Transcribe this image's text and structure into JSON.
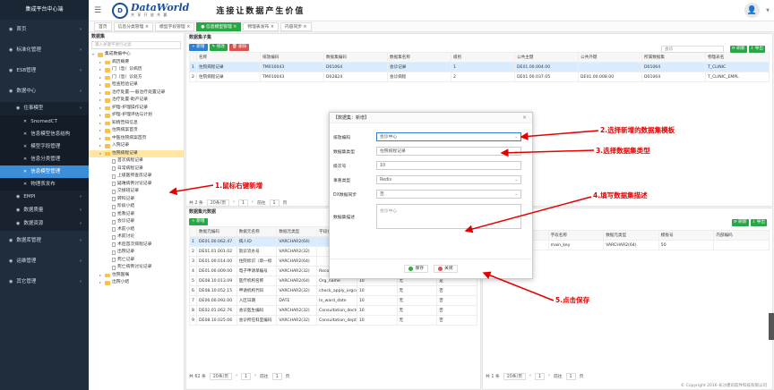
{
  "app_title": "集成平台中心端",
  "sidebar": {
    "items": [
      {
        "label": "首页",
        "level": 0
      },
      {
        "label": "标准化管理",
        "level": 0
      },
      {
        "label": "ESB管理",
        "level": 0
      },
      {
        "label": "数据中心",
        "level": 0
      },
      {
        "label": "住事模型",
        "level": 1
      },
      {
        "label": "SnomedCT",
        "level": 2
      },
      {
        "label": "信息模型信息结构",
        "level": 2
      },
      {
        "label": "模型字段管理",
        "level": 2
      },
      {
        "label": "信息分类管理",
        "level": 2
      },
      {
        "label": "信息模型管理",
        "level": 2,
        "active": true
      },
      {
        "label": "物理表发布",
        "level": 2
      },
      {
        "label": "EMPI",
        "level": 1
      },
      {
        "label": "数据质量",
        "level": 1
      },
      {
        "label": "数据资源",
        "level": 1
      },
      {
        "label": "数据库管理",
        "level": 0
      },
      {
        "label": "运维管理",
        "level": 0
      },
      {
        "label": "其它管理",
        "level": 0
      }
    ]
  },
  "header": {
    "logo_text": "DataWorld",
    "logo_sub": "共 享 开 放 共 赢",
    "slogan": "连接让数据产生价值"
  },
  "tabs": [
    {
      "label": "首页",
      "active": false
    },
    {
      "label": "信息分类管理 ×",
      "active": false
    },
    {
      "label": "模型字段管理 ×",
      "active": false
    },
    {
      "label": "● 信息模型管理 ×",
      "active": true
    },
    {
      "label": "物理表发布 ×",
      "active": false
    },
    {
      "label": "内容同步 ×",
      "active": false
    }
  ],
  "tree": {
    "title": "数据集",
    "search_placeholder": "输入关键字进行过滤",
    "nodes": [
      {
        "label": "集成数据中心",
        "depth": 0,
        "type": "folder",
        "open": true
      },
      {
        "label": "病历概要",
        "depth": 1,
        "type": "folder"
      },
      {
        "label": "门（急）诊病历",
        "depth": 1,
        "type": "folder"
      },
      {
        "label": "门（急）诊处方",
        "depth": 1,
        "type": "folder"
      },
      {
        "label": "检查检验记录",
        "depth": 1,
        "type": "folder"
      },
      {
        "label": "治疗处置-一般治疗处置记录",
        "depth": 1,
        "type": "folder"
      },
      {
        "label": "治疗处置-助产记录",
        "depth": 1,
        "type": "folder"
      },
      {
        "label": "护理-护理操作记录",
        "depth": 1,
        "type": "folder"
      },
      {
        "label": "护理-护理评估与计划",
        "depth": 1,
        "type": "folder"
      },
      {
        "label": "知情告知信息",
        "depth": 1,
        "type": "folder"
      },
      {
        "label": "住院病案首页",
        "depth": 1,
        "type": "folder"
      },
      {
        "label": "中医住院病案首页",
        "depth": 1,
        "type": "folder"
      },
      {
        "label": "入院记录",
        "depth": 1,
        "type": "folder"
      },
      {
        "label": "住院病程记录",
        "depth": 1,
        "type": "folder",
        "open": true,
        "selected": true
      },
      {
        "label": "首次病程记录",
        "depth": 2,
        "type": "file"
      },
      {
        "label": "日常病程记录",
        "depth": 2,
        "type": "file"
      },
      {
        "label": "上级医师查房记录",
        "depth": 2,
        "type": "file"
      },
      {
        "label": "疑难病例讨论记录",
        "depth": 2,
        "type": "file"
      },
      {
        "label": "交接班记录",
        "depth": 2,
        "type": "file"
      },
      {
        "label": "转科记录",
        "depth": 2,
        "type": "file"
      },
      {
        "label": "阶段小结",
        "depth": 2,
        "type": "file"
      },
      {
        "label": "抢救记录",
        "depth": 2,
        "type": "file"
      },
      {
        "label": "会诊记录",
        "depth": 2,
        "type": "file"
      },
      {
        "label": "术前小结",
        "depth": 2,
        "type": "file"
      },
      {
        "label": "术前讨论",
        "depth": 2,
        "type": "file"
      },
      {
        "label": "术后首次病程记录",
        "depth": 2,
        "type": "file"
      },
      {
        "label": "出院记录",
        "depth": 2,
        "type": "file"
      },
      {
        "label": "死亡记录",
        "depth": 2,
        "type": "file"
      },
      {
        "label": "死亡病例讨论记录",
        "depth": 2,
        "type": "file"
      },
      {
        "label": "住院医嘱",
        "depth": 1,
        "type": "folder"
      },
      {
        "label": "出院小结",
        "depth": 1,
        "type": "folder"
      }
    ]
  },
  "top_panel": {
    "title": "数据集子集",
    "buttons": {
      "add": "+ 新增",
      "edit": "✎ 修改",
      "delete": "🗑 删除"
    },
    "search_value": "会诊",
    "right_buttons": {
      "refresh": "⟳ 刷新",
      "export": "⇩ 导出"
    },
    "columns": [
      "",
      "名称",
      "排放编码",
      "数据集编码",
      "数据集名称",
      "级别",
      "公共主键",
      "公共外键",
      "所属数据集",
      "物理表名"
    ],
    "rows": [
      [
        "1",
        "住院病程记录",
        "TM010043",
        "D01064",
        "会诊记录",
        "1",
        "DE01.00.004.00",
        "",
        "D01064",
        "T_CLINIC"
      ],
      [
        "2",
        "住院病程记录",
        "TM010043",
        "D02824",
        "会诊病程",
        "2",
        "DE01.00.037.05",
        "DE01.00.008.00",
        "D01064",
        "T_CLINIC_EMPL"
      ]
    ],
    "pager": {
      "total": "共 2 条",
      "size": "20条/页",
      "prev": "前往",
      "page": "1",
      "unit": "页"
    }
  },
  "bottom_panel": {
    "title": "数据集元数据",
    "add_button": "+ 新增",
    "columns": [
      "",
      "数据元编码",
      "数据元名称",
      "数据元类型",
      "字段名",
      "长度",
      "约束",
      "主键"
    ],
    "rows": [
      [
        "1",
        "DE01.00.062.47",
        "病人ID",
        "VARCHAR2(64)",
        "",
        "",
        "",
        ""
      ],
      [
        "2",
        "DE01.01.001.02",
        "就诊流水号",
        "VARCHAR2(32)",
        "",
        "",
        "",
        ""
      ],
      [
        "3",
        "DE01.00.014.00",
        "住院标识（单一标",
        "VARCHAR2(64)",
        "",
        "",
        "",
        ""
      ],
      [
        "4",
        "DE01.00.009.00",
        "电子申请单编号",
        "VARCHAR2(32)",
        "Record_form_sn",
        "7",
        "主键",
        "否"
      ],
      [
        "5",
        "DE08.10.013.09",
        "医疗机构名称",
        "VARCHAR2(64)",
        "Org_name",
        "10",
        "无",
        "是"
      ],
      [
        "6",
        "DE08.10.052.15",
        "申请机构代码",
        "VARCHAR2(32)",
        "check_apply_orgcode",
        "10",
        "无",
        "否"
      ],
      [
        "7",
        "DE06.00.092.00",
        "入区日期",
        "DATE",
        "In_ward_date",
        "10",
        "无",
        "否"
      ],
      [
        "8",
        "DE02.01.062.76",
        "会诊医生编码",
        "VARCHAR2(32)",
        "Consultation_doctor",
        "10",
        "无",
        "否"
      ],
      [
        "9",
        "DE08.10.025.06",
        "会诊所在科室编码",
        "VARCHAR2(32)",
        "Consultation_dept_code",
        "10",
        "无",
        "否"
      ]
    ],
    "pager": {
      "total": "共 62 条",
      "size": "20条/页",
      "prev": "前往",
      "page": "1",
      "unit": "页"
    }
  },
  "right_panel": {
    "right_buttons": {
      "refresh": "⟳ 刷新",
      "export": "⇩ 导出"
    },
    "columns": [
      "",
      "数据元名称",
      "字段名称",
      "数据元类型",
      "模板号",
      "内部编码"
    ],
    "rows": [
      [
        "1",
        "公共主键",
        "main_key",
        "VARCHAR2(64)",
        "50",
        ""
      ]
    ],
    "pager": {
      "total": "共 1 条",
      "size": "20条/页",
      "prev": "前往",
      "page": "1",
      "unit": "页"
    }
  },
  "dialog": {
    "title": "【数据集：新增】",
    "fields": [
      {
        "label": "排放编码",
        "value": "会诊中心",
        "type": "select"
      },
      {
        "label": "数据集类型",
        "value": "住院病程记录",
        "type": "select"
      },
      {
        "label": "级次号",
        "value": "10",
        "type": "text"
      },
      {
        "label": "事重类型",
        "value": "Redis",
        "type": "select"
      },
      {
        "label": "DX数据同步",
        "value": "否",
        "type": "select"
      },
      {
        "label": "数据集描述",
        "value": "会诊中心",
        "type": "textarea"
      }
    ],
    "save": "保存",
    "close": "关闭"
  },
  "annotations": [
    "1.鼠标右键新增",
    "2.选择新增的数据集模板",
    "3.选择数据集类型",
    "4.填写数据集描述",
    "5.点击保存"
  ],
  "footer": "© Copyright 2016 长沙建讯软件科技有限公司",
  "colors": {
    "sidebar_bg": "#1f2d3d",
    "active_blue": "#3b8ed8",
    "accent_green": "#28a745",
    "annotation_red": "#e60000"
  }
}
